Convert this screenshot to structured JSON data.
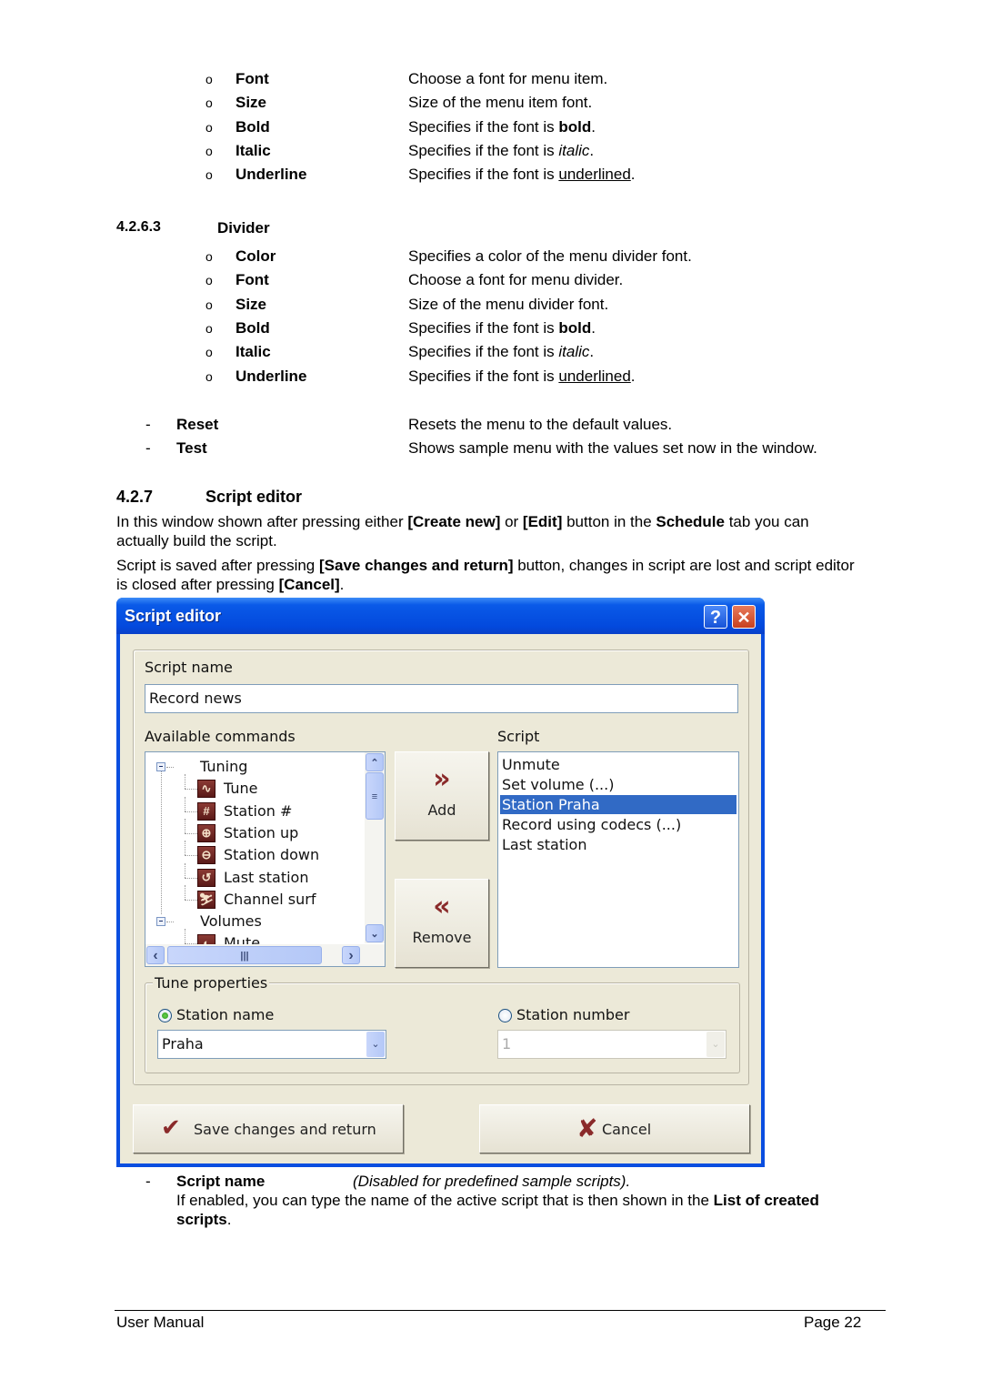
{
  "menu_item_props": [
    {
      "term": "Font",
      "desc_pre": "Choose a font for menu item.",
      "emph": "",
      "emph_style": "",
      "desc_post": ""
    },
    {
      "term": "Size",
      "desc_pre": "Size of the menu item font.",
      "emph": "",
      "emph_style": "",
      "desc_post": ""
    },
    {
      "term": "Bold",
      "desc_pre": "Specifies if the font is ",
      "emph": "bold",
      "emph_style": "bold",
      "desc_post": "."
    },
    {
      "term": "Italic",
      "desc_pre": "Specifies if the font is ",
      "emph": "italic",
      "emph_style": "italic",
      "desc_post": "."
    },
    {
      "term": "Underline",
      "desc_pre": "Specifies if the font is ",
      "emph": "underlined",
      "emph_style": "underline",
      "desc_post": "."
    }
  ],
  "divider_section": {
    "number": "4.2.6.3",
    "title": "Divider"
  },
  "divider_props": [
    {
      "term": "Color",
      "desc_pre": "Specifies a color of the menu divider font.",
      "emph": "",
      "emph_style": "",
      "desc_post": ""
    },
    {
      "term": "Font",
      "desc_pre": "Choose a font for menu divider.",
      "emph": "",
      "emph_style": "",
      "desc_post": ""
    },
    {
      "term": "Size",
      "desc_pre": "Size of the menu divider font.",
      "emph": "",
      "emph_style": "",
      "desc_post": ""
    },
    {
      "term": "Bold",
      "desc_pre": "Specifies if the font is ",
      "emph": "bold",
      "emph_style": "bold",
      "desc_post": "."
    },
    {
      "term": "Italic",
      "desc_pre": "Specifies if the font is ",
      "emph": "italic",
      "emph_style": "italic",
      "desc_post": "."
    },
    {
      "term": "Underline",
      "desc_pre": "Specifies if the font is ",
      "emph": "underlined",
      "emph_style": "underline",
      "desc_post": "."
    }
  ],
  "actions": [
    {
      "term": "Reset",
      "desc": "Resets the menu to the default values."
    },
    {
      "term": "Test",
      "desc": "Shows sample menu with the values set now in the window."
    }
  ],
  "script_section": {
    "number": "4.2.7",
    "title": "Script editor",
    "para1": {
      "t1": "In this window shown after pressing either ",
      "b1": "[Create new]",
      "t2": " or ",
      "b2": "[Edit]",
      "t3": " button in the ",
      "b3": "Schedule",
      "t4": " tab you can",
      "line2": "actually build the script."
    },
    "para2": {
      "t1": "Script is saved after pressing ",
      "b1": "[Save changes and return]",
      "t2": " button, changes in script are lost and script editor",
      "line2_t": "is closed after pressing ",
      "line2_b": "[Cancel]",
      "line2_end": "."
    }
  },
  "dialog": {
    "title": "Script editor",
    "help_glyph": "?",
    "close_glyph": "✕",
    "script_name_label": "Script name",
    "script_name_value": "Record news",
    "available_commands_label": "Available commands",
    "tree": [
      {
        "label": "Tuning",
        "type": "group"
      },
      {
        "label": "Tune",
        "type": "item",
        "icon": "tune-icon",
        "glyph": "∿"
      },
      {
        "label": "Station #",
        "type": "item",
        "icon": "station-number-icon",
        "glyph": "#"
      },
      {
        "label": "Station up",
        "type": "item",
        "icon": "station-up-icon",
        "glyph": "⊕"
      },
      {
        "label": "Station down",
        "type": "item",
        "icon": "station-down-icon",
        "glyph": "⊖"
      },
      {
        "label": "Last station",
        "type": "item",
        "icon": "last-station-icon",
        "glyph": "↺"
      },
      {
        "label": "Channel surf",
        "type": "item",
        "icon": "channel-surf-icon",
        "glyph": "⛷"
      },
      {
        "label": "Volumes",
        "type": "group"
      },
      {
        "label": "Mute",
        "type": "item",
        "icon": "mute-icon",
        "glyph": "◐"
      }
    ],
    "add_label": "Add",
    "add_glyph": "»",
    "remove_label": "Remove",
    "remove_glyph": "«",
    "script_label": "Script",
    "script_items": [
      "Unmute",
      "Set volume (...)",
      "Station Praha",
      "Record using codecs (...)",
      "Last station"
    ],
    "selected_index": 2,
    "tune_properties_label": "Tune properties",
    "station_name_label": "Station name",
    "station_name_value": "Praha",
    "station_number_label": "Station number",
    "station_number_value": "1",
    "save_label": "Save changes and return",
    "cancel_label": "Cancel",
    "scroll_up": "⌃",
    "scroll_down": "⌄",
    "scroll_left": "‹",
    "scroll_right": "›",
    "combo_arrow": "⌄",
    "accent_color": "#316ac5"
  },
  "script_name_desc": {
    "term": "Script name",
    "note": "(Disabled for predefined sample scripts).",
    "line2_t": "If enabled, you can type the name of the active script that is then shown in the ",
    "line2_b": "List of created",
    "line3_b": "scripts",
    "line3_end": "."
  },
  "footer": {
    "left": "User Manual",
    "right": "Page 22"
  }
}
